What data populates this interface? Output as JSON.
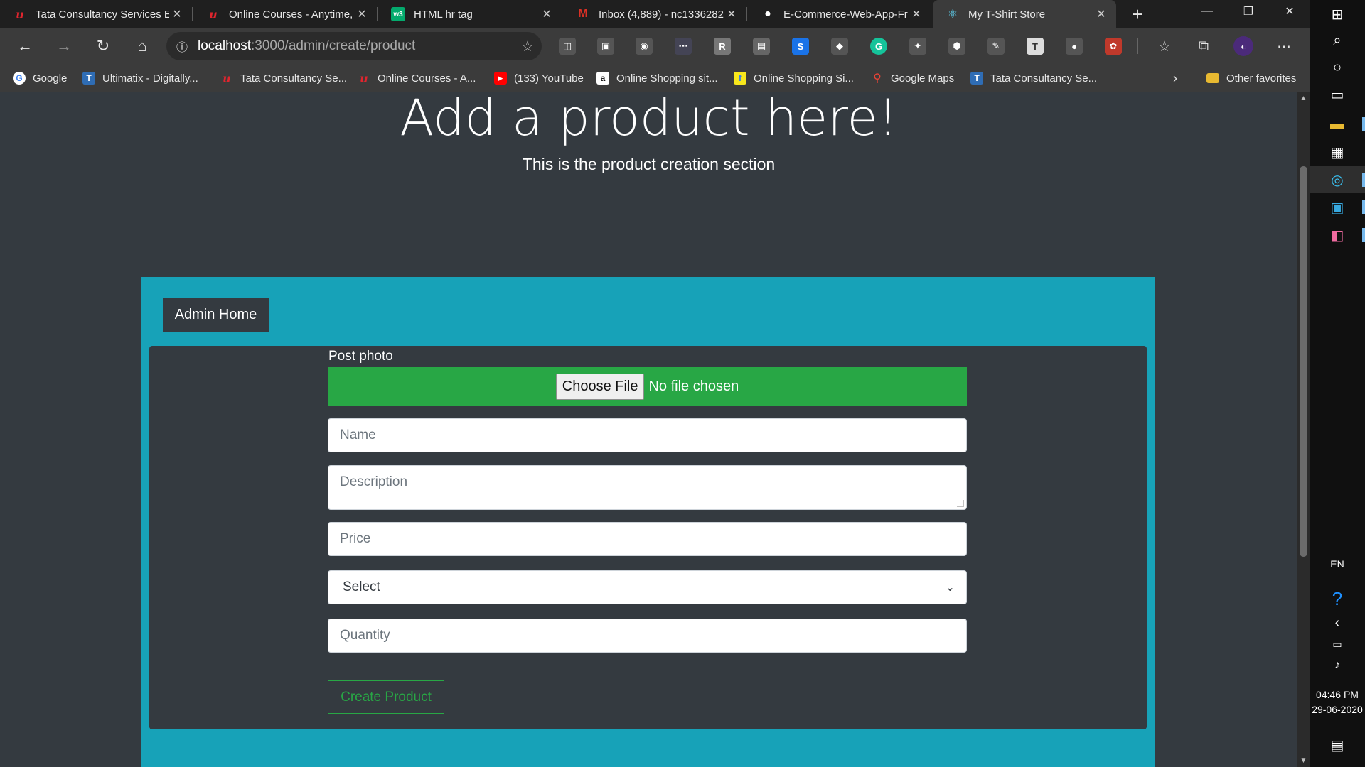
{
  "browser": {
    "tabs": [
      {
        "title": "Tata Consultancy Services E",
        "icon": "ultimatix-icon",
        "active": false
      },
      {
        "title": "Online Courses - Anytime,",
        "icon": "ultimatix-icon",
        "active": false
      },
      {
        "title": "HTML hr tag",
        "icon": "w3schools-icon",
        "active": false
      },
      {
        "title": "Inbox (4,889) - nc1336282",
        "icon": "gmail-icon",
        "active": false
      },
      {
        "title": "E-Commerce-Web-App-Fr",
        "icon": "github-icon",
        "active": false
      },
      {
        "title": "My T-Shirt Store",
        "icon": "react-icon",
        "active": true
      }
    ],
    "address": {
      "host": "localhost",
      "path": ":3000/admin/create/product"
    },
    "bookmarks": [
      {
        "label": "Google",
        "icon": "google-icon"
      },
      {
        "label": "Ultimatix - Digitally...",
        "icon": "tata-icon"
      },
      {
        "label": "Tata Consultancy Se...",
        "icon": "ultimatix-icon"
      },
      {
        "label": "Online Courses - A...",
        "icon": "ultimatix-icon"
      },
      {
        "label": "(133) YouTube",
        "icon": "youtube-icon"
      },
      {
        "label": "Online Shopping sit...",
        "icon": "amazon-icon"
      },
      {
        "label": "Online Shopping Si...",
        "icon": "flipkart-icon"
      },
      {
        "label": "Google Maps",
        "icon": "maps-icon"
      },
      {
        "label": "Tata Consultancy Se...",
        "icon": "tata-icon"
      }
    ],
    "other_favorites": "Other favorites"
  },
  "page": {
    "title": "Add a product here!",
    "subtitle": "This is the product creation section",
    "admin_home": "Admin Home",
    "form": {
      "photo_label": "Post photo",
      "choose_file": "Choose File",
      "no_file": "No file chosen",
      "name_placeholder": "Name",
      "description_placeholder": "Description",
      "price_placeholder": "Price",
      "category_value": "Select",
      "quantity_placeholder": "Quantity",
      "submit": "Create Product"
    }
  },
  "taskbar": {
    "language": "EN",
    "time": "04:46 PM",
    "date": "29-06-2020"
  },
  "colors": {
    "page_bg": "#343a40",
    "panel": "#17a2b8",
    "success": "#28a745"
  }
}
